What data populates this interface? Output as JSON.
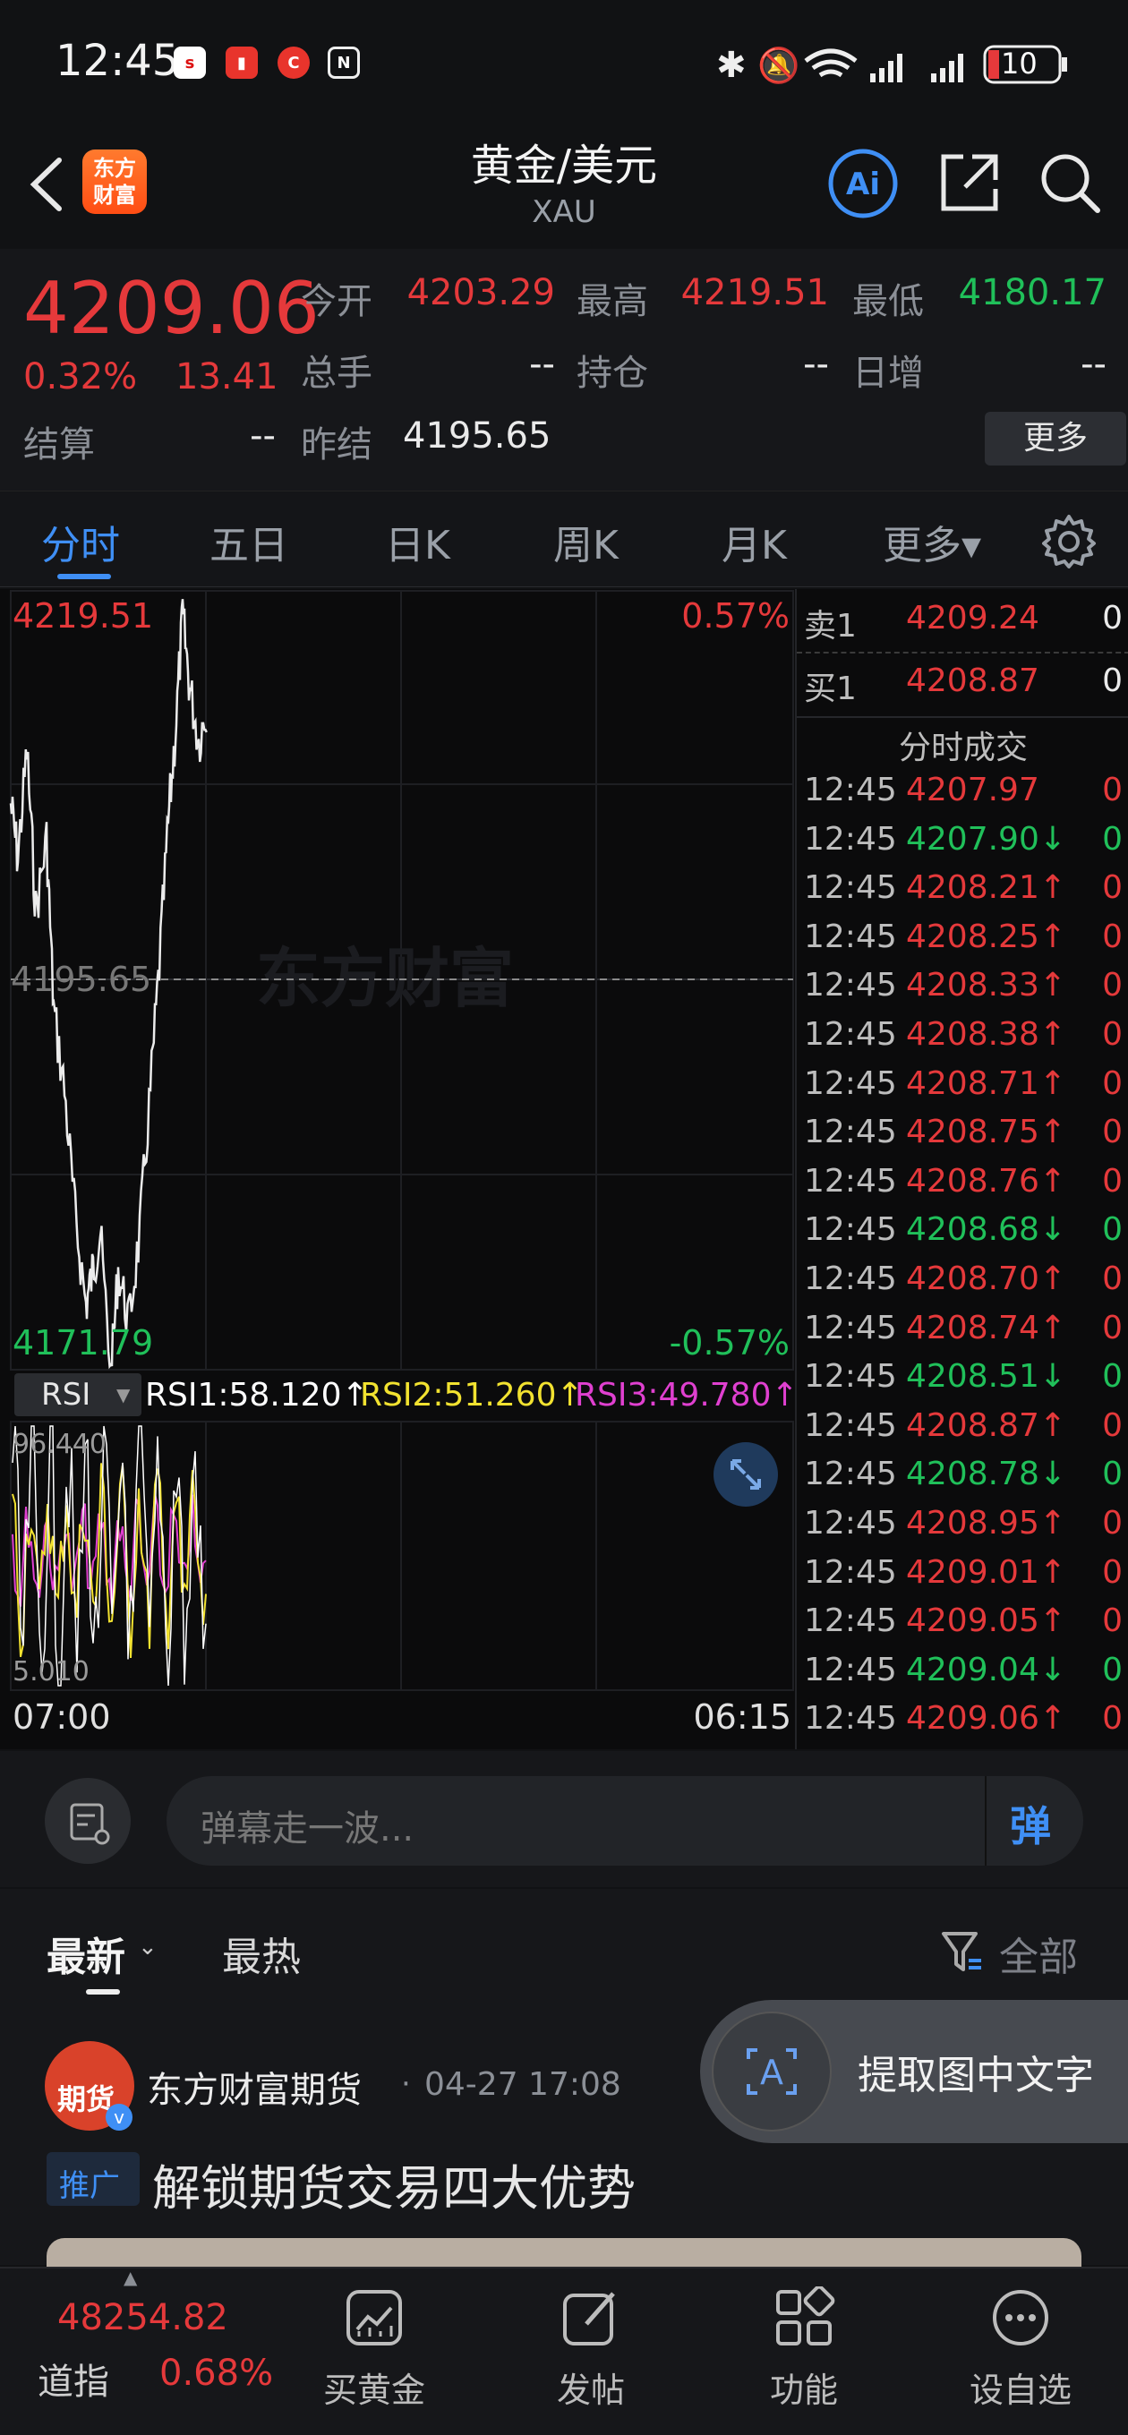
{
  "status_bar": {
    "time": "12:45",
    "battery": "10"
  },
  "header": {
    "app_logo_line1": "东方",
    "app_logo_line2": "财富",
    "title": "黄金/美元",
    "subtitle": "XAU"
  },
  "quote": {
    "price": "4209.06",
    "change_pct": "0.32%",
    "change_abs": "13.41",
    "settle_label": "结算",
    "settle_value": "--",
    "open_label": "今开",
    "open_value": "4203.29",
    "high_label": "最高",
    "high_value": "4219.51",
    "low_label": "最低",
    "low_value": "4180.17",
    "volume_label": "总手",
    "volume_value": "--",
    "position_label": "持仓",
    "position_value": "--",
    "daily_inc_label": "日增",
    "daily_inc_value": "--",
    "prev_settle_label": "昨结",
    "prev_settle_value": "4195.65",
    "more_label": "更多"
  },
  "tabs": [
    {
      "label": "分时",
      "active": true
    },
    {
      "label": "五日"
    },
    {
      "label": "日K"
    },
    {
      "label": "周K"
    },
    {
      "label": "月K"
    },
    {
      "label": "更多▾"
    }
  ],
  "chart": {
    "high_label": "4219.51",
    "high_pct": "0.57%",
    "mid_label": "4195.65",
    "low_label": "4171.79",
    "low_pct": "-0.57%",
    "watermark": "东方财富",
    "start_time": "07:00",
    "end_time": "06:15",
    "indicator": "RSI",
    "rsi1": "RSI1:58.120↑",
    "rsi2": "RSI2:51.260↑",
    "rsi3": "RSI3:49.780↑",
    "rsi_max": "96.440",
    "rsi_min": "5.010"
  },
  "order_book": {
    "sell_label": "卖1",
    "sell_price": "4209.24",
    "sell_vol": "0",
    "buy_label": "买1",
    "buy_price": "4208.87",
    "buy_vol": "0",
    "ticks_title": "分时成交"
  },
  "ticks": [
    {
      "time": "12:45",
      "price": "4207.97",
      "dir": "",
      "vol": "0",
      "color": "red"
    },
    {
      "time": "12:45",
      "price": "4207.90↓",
      "dir": "down",
      "vol": "0",
      "color": "green"
    },
    {
      "time": "12:45",
      "price": "4208.21↑",
      "dir": "up",
      "vol": "0",
      "color": "red"
    },
    {
      "time": "12:45",
      "price": "4208.25↑",
      "dir": "up",
      "vol": "0",
      "color": "red"
    },
    {
      "time": "12:45",
      "price": "4208.33↑",
      "dir": "up",
      "vol": "0",
      "color": "red"
    },
    {
      "time": "12:45",
      "price": "4208.38↑",
      "dir": "up",
      "vol": "0",
      "color": "red"
    },
    {
      "time": "12:45",
      "price": "4208.71↑",
      "dir": "up",
      "vol": "0",
      "color": "red"
    },
    {
      "time": "12:45",
      "price": "4208.75↑",
      "dir": "up",
      "vol": "0",
      "color": "red"
    },
    {
      "time": "12:45",
      "price": "4208.76↑",
      "dir": "up",
      "vol": "0",
      "color": "red"
    },
    {
      "time": "12:45",
      "price": "4208.68↓",
      "dir": "down",
      "vol": "0",
      "color": "green"
    },
    {
      "time": "12:45",
      "price": "4208.70↑",
      "dir": "up",
      "vol": "0",
      "color": "red"
    },
    {
      "time": "12:45",
      "price": "4208.74↑",
      "dir": "up",
      "vol": "0",
      "color": "red"
    },
    {
      "time": "12:45",
      "price": "4208.51↓",
      "dir": "down",
      "vol": "0",
      "color": "green"
    },
    {
      "time": "12:45",
      "price": "4208.87↑",
      "dir": "up",
      "vol": "0",
      "color": "red"
    },
    {
      "time": "12:45",
      "price": "4208.78↓",
      "dir": "down",
      "vol": "0",
      "color": "green"
    },
    {
      "time": "12:45",
      "price": "4208.95↑",
      "dir": "up",
      "vol": "0",
      "color": "red"
    },
    {
      "time": "12:45",
      "price": "4209.01↑",
      "dir": "up",
      "vol": "0",
      "color": "red"
    },
    {
      "time": "12:45",
      "price": "4209.05↑",
      "dir": "up",
      "vol": "0",
      "color": "red"
    },
    {
      "time": "12:45",
      "price": "4209.04↓",
      "dir": "down",
      "vol": "0",
      "color": "green"
    },
    {
      "time": "12:45",
      "price": "4209.06↑",
      "dir": "up",
      "vol": "0",
      "color": "red"
    }
  ],
  "danmaku": {
    "placeholder": "弹幕走一波...",
    "send_label": "弹"
  },
  "feed": {
    "tab_latest": "最新",
    "tab_hot": "最热",
    "filter_label": "全部",
    "post_author": "东方财富期货",
    "post_time": "04-27 17:08",
    "avatar_text": "期货",
    "promo_tag": "推广",
    "post_title": "解锁期货交易四大优势",
    "ocr_label": "提取图中文字"
  },
  "bottom_nav": {
    "index_value": "48254.82",
    "index_label": "道指",
    "index_change": "0.68%",
    "items": [
      {
        "label": "买黄金"
      },
      {
        "label": "发帖"
      },
      {
        "label": "功能"
      },
      {
        "label": "设自选"
      }
    ]
  },
  "colors": {
    "up": "#e5393b",
    "down": "#20c05a",
    "accent": "#3f8ff5",
    "rsi1": "#ffffff",
    "rsi2": "#f2e230",
    "rsi3": "#e040d0"
  }
}
